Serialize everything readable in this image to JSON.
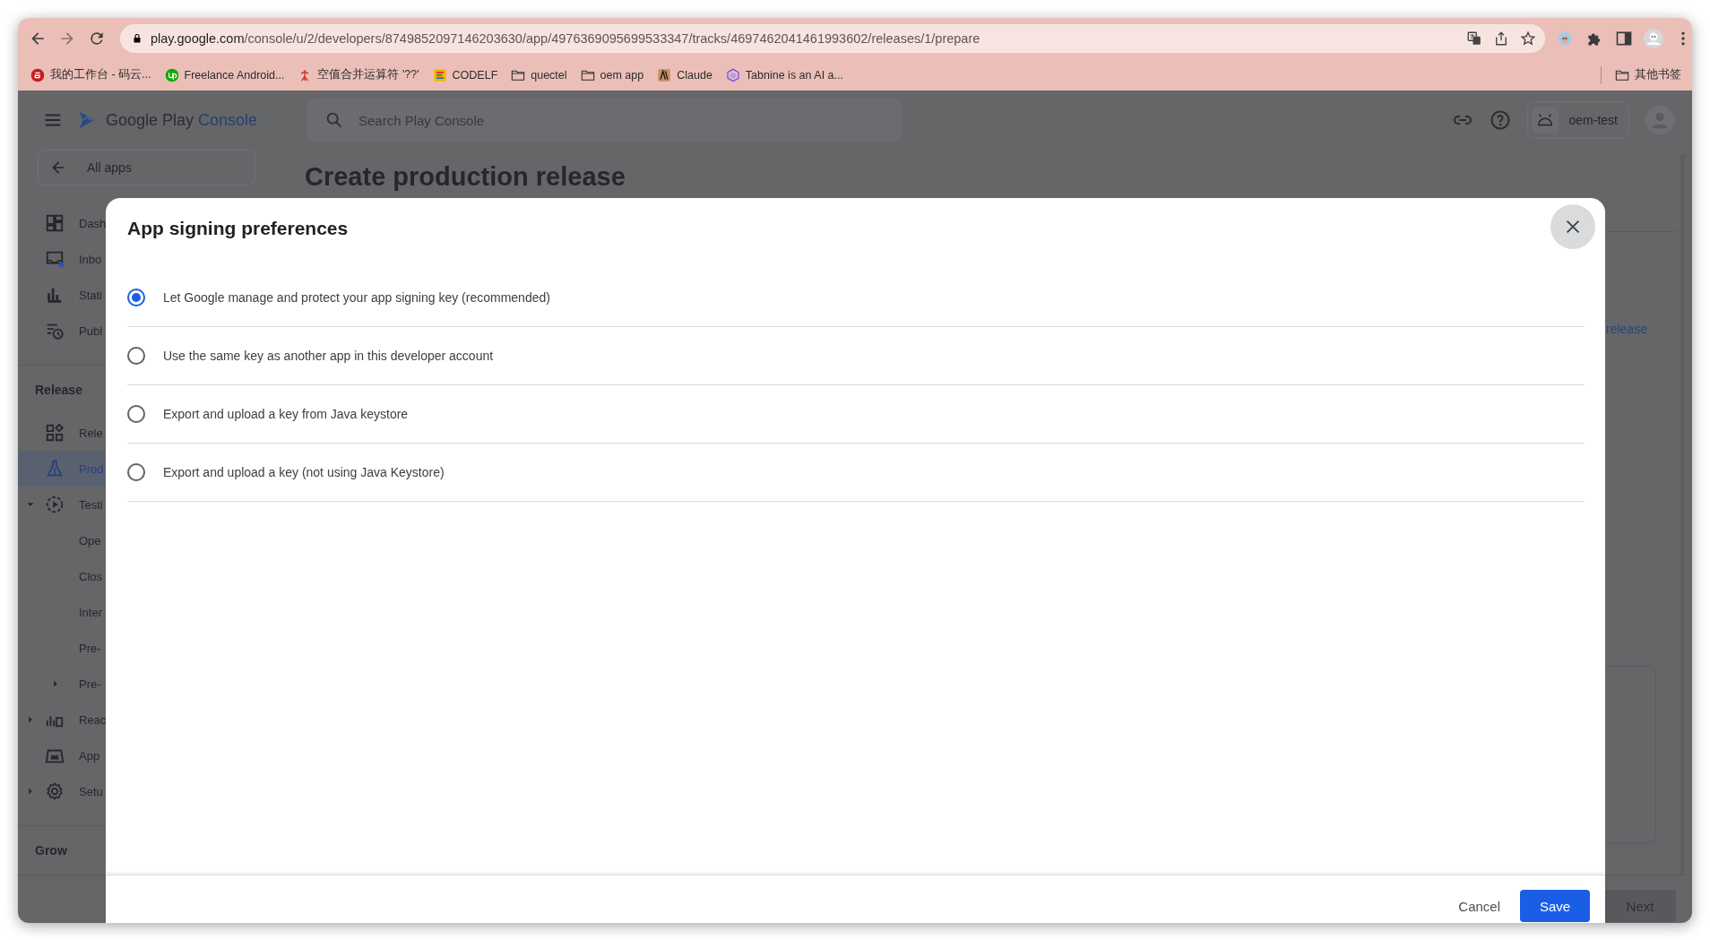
{
  "browser": {
    "url": {
      "host": "play.google.com",
      "path": "/console/u/2/developers/8749852097146203630/app/4976369095699533347/tracks/4697462041461993602/releases/1/prepare"
    },
    "bookmarks": [
      {
        "label": "我的工作台 - 码云...",
        "kind": "site"
      },
      {
        "label": "Freelance Android...",
        "kind": "site"
      },
      {
        "label": "空值合并运算符 '??'",
        "kind": "site"
      },
      {
        "label": "CODELF",
        "kind": "site"
      },
      {
        "label": "quectel",
        "kind": "folder"
      },
      {
        "label": "oem app",
        "kind": "folder"
      },
      {
        "label": "Claude",
        "kind": "site"
      },
      {
        "label": "Tabnine is an AI a...",
        "kind": "site"
      }
    ],
    "other_bookmarks": {
      "label": "其他书签",
      "kind": "folder"
    }
  },
  "app_header": {
    "brand": {
      "name": "Google Play",
      "suffix": "Console"
    },
    "search": {
      "placeholder": "Search Play Console"
    },
    "account": "oem-test"
  },
  "sidebar": {
    "back_link": "All apps",
    "items": [
      {
        "label": "Dash",
        "selected": false
      },
      {
        "label": "Inbo",
        "selected": false
      },
      {
        "label": "Stati",
        "selected": false
      },
      {
        "label": "Publ",
        "selected": false
      }
    ],
    "sections": [
      {
        "title": "Release",
        "items": [
          {
            "label": "Rele",
            "selected": false
          },
          {
            "label": "Prod",
            "selected": true
          },
          {
            "label": "Testi",
            "selected": false,
            "expanded": true,
            "children": [
              {
                "label": "Ope",
                "selected": false
              },
              {
                "label": "Clos",
                "selected": false
              },
              {
                "label": "Inter",
                "selected": false
              },
              {
                "label": "Pre-",
                "selected": false
              },
              {
                "label": "Pre-",
                "selected": false,
                "expanded": false
              }
            ]
          },
          {
            "label": "Reac",
            "selected": false,
            "expanded": false
          },
          {
            "label": "App",
            "selected": false
          },
          {
            "label": "Setu",
            "selected": false,
            "expanded": false
          }
        ]
      },
      {
        "title": "Grow"
      }
    ]
  },
  "page": {
    "title": "Create production release",
    "link": "release",
    "next_button": {
      "label": "Next",
      "disabled": true
    }
  },
  "dialog": {
    "title": "App signing preferences",
    "options": [
      {
        "label": "Let Google manage and protect your app signing key (recommended)",
        "selected": true
      },
      {
        "label": "Use the same key as another app in this developer account",
        "selected": false
      },
      {
        "label": "Export and upload a key from Java keystore",
        "selected": false
      },
      {
        "label": "Export and upload a key (not using Java Keystore)",
        "selected": false
      }
    ],
    "cancel_button": "Cancel",
    "save_button": "Save"
  }
}
